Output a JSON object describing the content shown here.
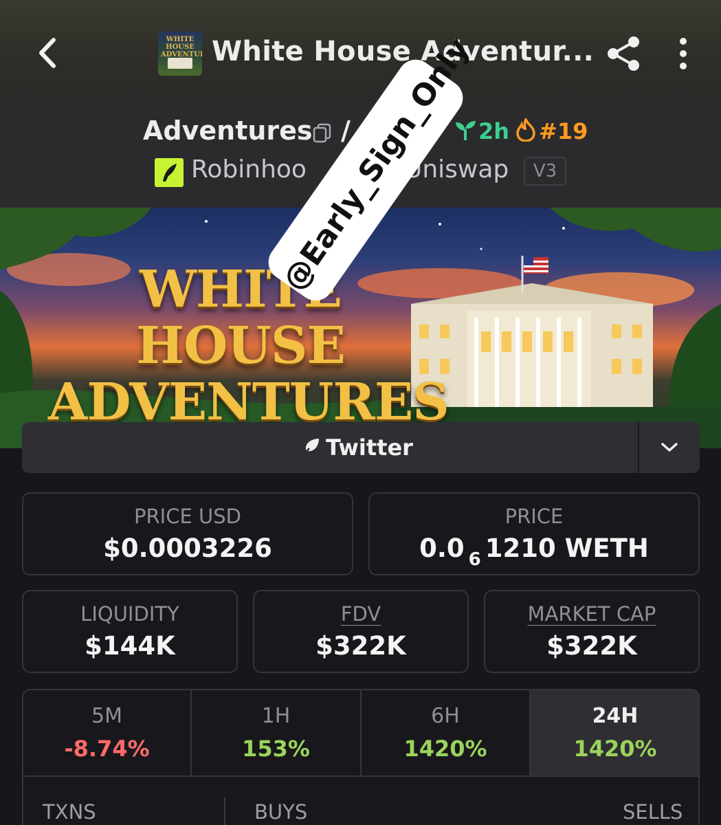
{
  "topbar": {
    "title": "White House Adventur...",
    "thumbnail_text": "WHITE HOUSE ADVENTURES"
  },
  "token": {
    "name": "Adventures",
    "pair_separator": "/",
    "quote_partial": "H",
    "age": "2h",
    "rank": "#19",
    "chain": "Robinhoo",
    "dex": "Uniswap",
    "version": "V3"
  },
  "banner": {
    "line1": "WHITE HOUSE",
    "line2": "ADVENTURES"
  },
  "twitter": {
    "label": "Twitter"
  },
  "stats": {
    "price_usd": {
      "label": "PRICE USD",
      "value": "$0.0003226"
    },
    "price": {
      "label": "PRICE",
      "value_prefix": "0.0",
      "value_sub": "6",
      "value_suffix": "1210 WETH"
    },
    "liquidity": {
      "label": "LIQUIDITY",
      "value": "$144K"
    },
    "fdv": {
      "label": "FDV",
      "value": "$322K"
    },
    "market_cap": {
      "label": "MARKET CAP",
      "value": "$322K"
    }
  },
  "changes": [
    {
      "label": "5M",
      "value": "-8.74%"
    },
    {
      "label": "1H",
      "value": "153%"
    },
    {
      "label": "6H",
      "value": "1420%"
    },
    {
      "label": "24H",
      "value": "1420%"
    }
  ],
  "txns": {
    "label": "TXNS",
    "buys": "BUYS",
    "sells": "SELLS"
  },
  "watermark": "@Early_Sign_Only",
  "colors": {
    "accent_green": "#3ecf8e",
    "rank_orange": "#ff9a1f",
    "negative": "#ff6a6a",
    "positive": "#9bd35c"
  }
}
